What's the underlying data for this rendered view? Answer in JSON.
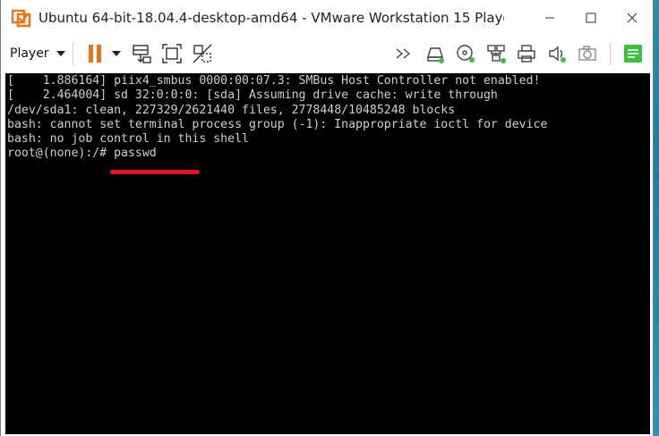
{
  "window": {
    "title": "Ubuntu 64-bit-18.04.4-desktop-amd64 - VMware Workstation 15 Player (..."
  },
  "toolbar": {
    "player_label": "Player",
    "icons": [
      "pause-icon",
      "dropdown-arrow-icon",
      "send-ctrl-alt-del-icon",
      "fullscreen-icon",
      "unity-icon",
      "forward-icon",
      "hard-disk-icon",
      "cd-dvd-icon",
      "network-icon",
      "printer-icon",
      "sound-icon",
      "camera-icon",
      "notes-icon"
    ]
  },
  "console": {
    "lines": [
      "[    1.886164] piix4_smbus 0000:00:07.3: SMBus Host Controller not enabled!",
      "[    2.464004] sd 32:0:0:0: [sda] Assuming drive cache: write through",
      "/dev/sda1: clean, 227329/2621440 files, 2778448/10485248 blocks",
      "bash: cannot set terminal process group (-1): Inappropriate ioctl for device",
      "bash: no job control in this shell",
      "root@(none):/# passwd"
    ]
  },
  "colors": {
    "accent_orange": "#e8751a",
    "green_status": "#3fbf3f",
    "annotation_red": "#e01a1a"
  }
}
